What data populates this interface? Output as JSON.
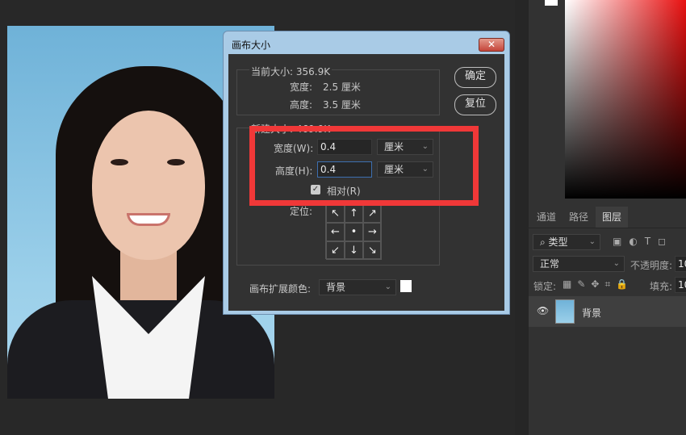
{
  "dialog": {
    "title": "画布大小",
    "close": "✕",
    "current_size": "当前大小: 356.9K",
    "width_label": "宽度:",
    "width_value": "2.5 厘米",
    "height_label": "高度:",
    "height_value": "3.5 厘米",
    "new_size": "新建大小: 469.9K",
    "new_width_label": "宽度(W):",
    "new_width_value": "0.4",
    "new_width_unit": "厘米",
    "new_height_label": "高度(H):",
    "new_height_value": "0.4",
    "new_height_unit": "厘米",
    "relative_label": "相对(R)",
    "relative_checked": true,
    "anchor_label": "定位:",
    "anchor": [
      "↖",
      "↑",
      "↗",
      "←",
      "•",
      "→",
      "↙",
      "↓",
      "↘"
    ],
    "ext_color_label": "画布扩展颜色:",
    "ext_color_value": "背景",
    "ok": "确定",
    "reset": "复位"
  },
  "panel": {
    "tabs": [
      "通道",
      "路径",
      "图层"
    ],
    "active_tab": "图层",
    "filter": "类型",
    "blend_mode": "正常",
    "opacity_label": "不透明度:",
    "opacity_value": "10",
    "lock_label": "锁定:",
    "fill_label": "填充:",
    "fill_value": "10",
    "layer_name": "背景"
  },
  "colors": {
    "highlight": "#f03838"
  }
}
